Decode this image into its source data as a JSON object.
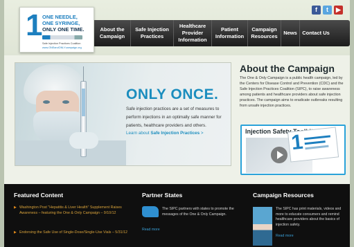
{
  "social": {
    "facebook": "f",
    "twitter": "t",
    "youtube": "▶"
  },
  "logo": {
    "one": "1",
    "line1": "ONE NEEDLE,",
    "line2": "ONE SYRINGE,",
    "line3": "ONLY ONE TIME.",
    "sub": "Safe Injection Practices Coalition",
    "url": "www.ONEandONLYcampaign.org"
  },
  "nav": [
    {
      "label": "About the Campaign"
    },
    {
      "label": "Safe Injection Practices"
    },
    {
      "label": "Healthcare Provider Information"
    },
    {
      "label": "Patient Information"
    },
    {
      "label": "Campaign Resources"
    },
    {
      "label": "News"
    },
    {
      "label": "Contact Us"
    }
  ],
  "hero": {
    "title": "ONLY ONCE.",
    "text": "Safe injection practices are a set of measures to perform injections in an optimally safe manner for patients, healthcare providers and others.",
    "link_prefix": "Learn about ",
    "link_bold": "Safe Injection Practices",
    "link_arrow": " >"
  },
  "about": {
    "title": "About the Campaign",
    "text": "The One & Only Campaign is a public health campaign, led by the Centers for Disease Control and Prevention (CDC) and the Safe Injection Practices Coalition (SIPC), to raise awareness among patients and healthcare providers about safe injection practices. The campaign aims to eradicate outbreaks resulting from unsafe injection practices."
  },
  "toolkit": {
    "title": "Injection Safety Toolkits",
    "brochure_number": "1"
  },
  "featured": {
    "title": "Featured Content",
    "items": [
      "Washington Post \"Hepatitis & Liver Health\" Supplement Raises Awareness – featuring the One & Only Campaign – 9/10/12",
      "Endorsing the Safe Use of Single-Dose/Single-Use Vials – 5/31/12"
    ]
  },
  "partners": {
    "title": "Partner States",
    "text": "The SIPC partners with states to promote the messages of the One & Only Campaign.",
    "read_more": "Read more"
  },
  "resources": {
    "title": "Campaign Resources",
    "text": "The SIPC has print materials, videos and more to educate consumers and remind healthcare providers about the basics of injection safety.",
    "read_more": "Read more"
  },
  "colors": {
    "accent": "#1b8dbe",
    "nav_bg": "#2a2a2a",
    "footer_bg": "#0f0f0f",
    "link_orange": "#d8a23a"
  }
}
